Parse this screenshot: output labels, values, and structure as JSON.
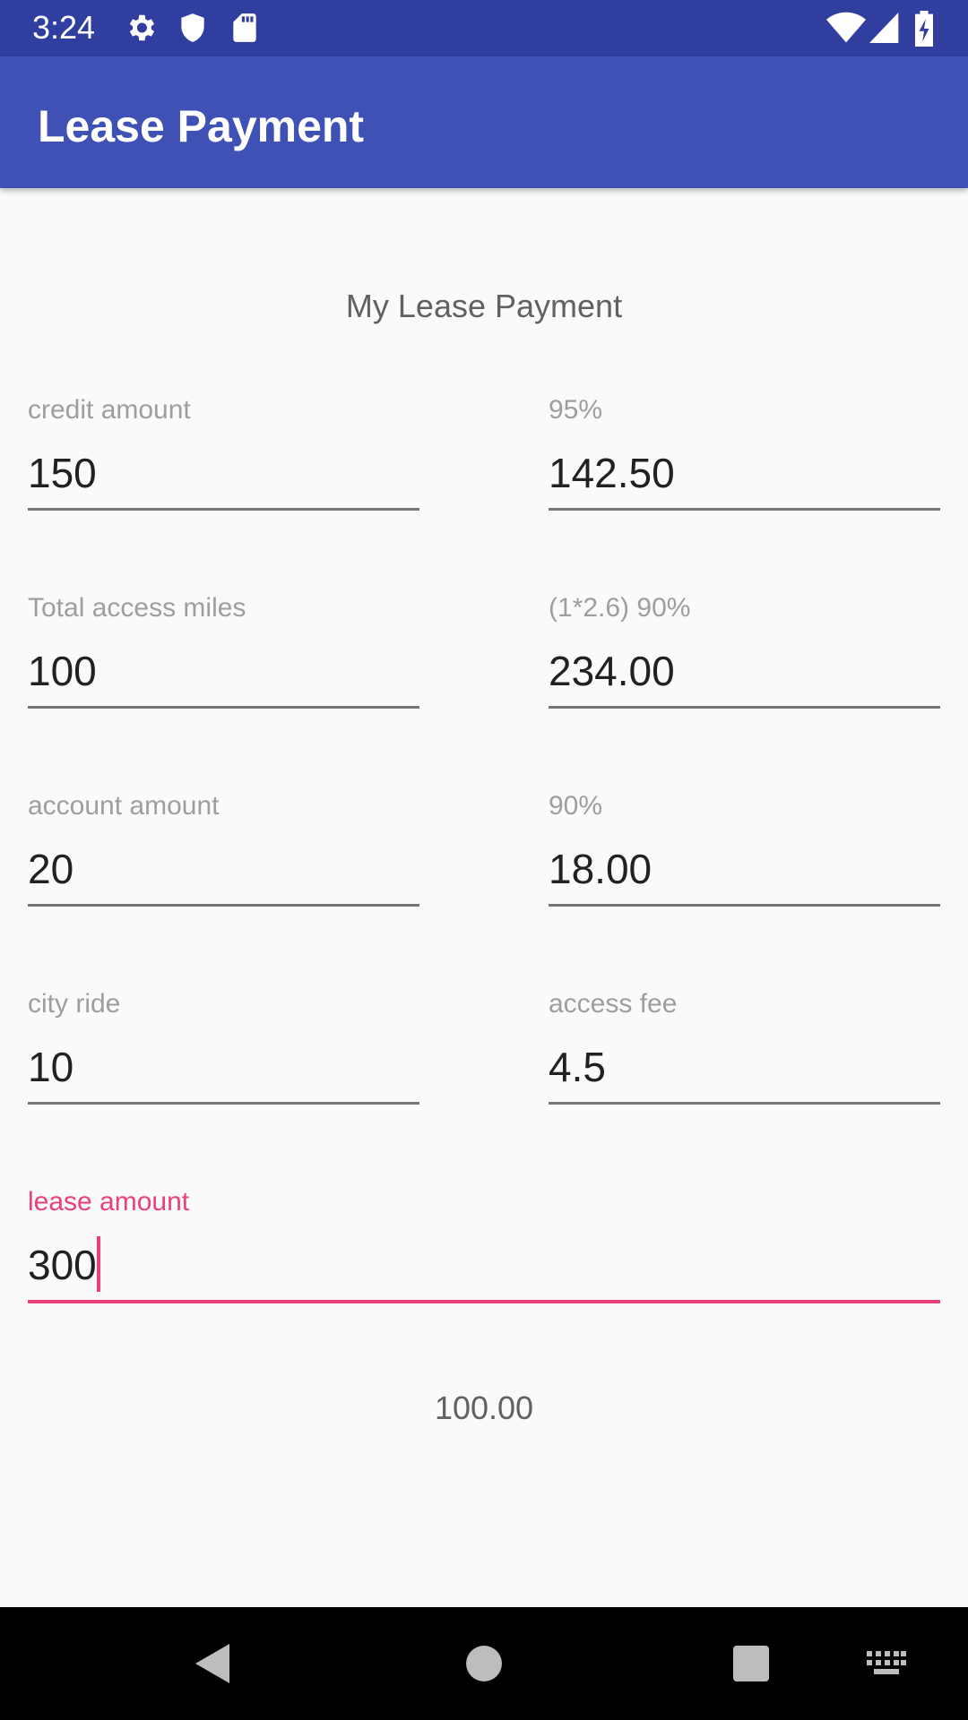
{
  "status_bar": {
    "time": "3:24",
    "icons": [
      "gear-icon",
      "shield-icon",
      "sd-card-icon",
      "wifi-icon",
      "signal-icon",
      "battery-charging-icon"
    ]
  },
  "app_bar": {
    "title": "Lease Payment"
  },
  "main": {
    "heading": "My Lease Payment",
    "fields": [
      {
        "label": "credit amount",
        "value": "150"
      },
      {
        "label": "95%",
        "value": "142.50"
      },
      {
        "label": "Total access miles",
        "value": "100"
      },
      {
        "label": "(1*2.6) 90%",
        "value": "234.00"
      },
      {
        "label": "account amount",
        "value": "20"
      },
      {
        "label": "90%",
        "value": "18.00"
      },
      {
        "label": "city ride",
        "value": "10"
      },
      {
        "label": "access fee",
        "value": "4.5"
      }
    ],
    "lease": {
      "label": "lease amount",
      "value": "300"
    },
    "result": "100.00"
  },
  "nav_bar": {
    "buttons": [
      "back-icon",
      "home-icon",
      "recents-icon",
      "keyboard-icon"
    ]
  },
  "colors": {
    "status_bar": "#303f9f",
    "app_bar": "#3f51b5",
    "accent": "#ec407a",
    "background": "#fafafa"
  }
}
